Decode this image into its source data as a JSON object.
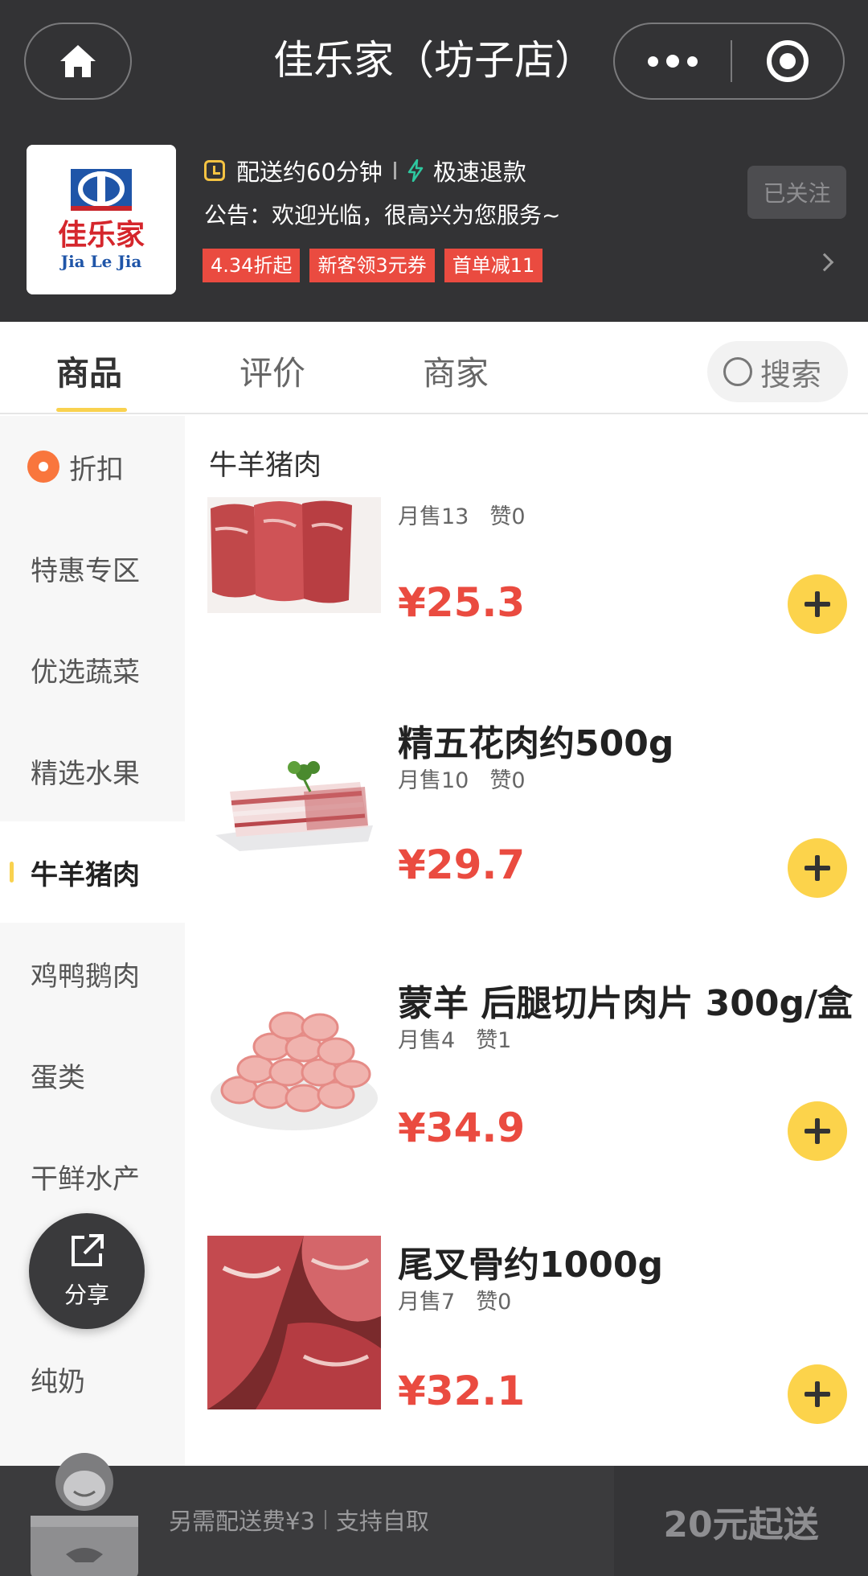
{
  "header": {
    "title": "佳乐家（坊子店）",
    "home_icon": "home-icon",
    "more_icon": "more-dots-icon",
    "close_icon": "target-circle-icon"
  },
  "store": {
    "logo_text_cn": "佳乐家",
    "logo_text_en": "Jia Le Jia",
    "delivery_time": "配送约60分钟",
    "refund": "极速退款",
    "notice": "公告：欢迎光临，很高兴为您服务~",
    "tags": [
      "4.34折起",
      "新客领3元券",
      "首单减11"
    ],
    "follow_label": "已关注"
  },
  "tabs": {
    "items": [
      "商品",
      "评价",
      "商家"
    ],
    "search_label": "搜索"
  },
  "sidebar": {
    "items": [
      {
        "label": "折扣"
      },
      {
        "label": "特惠专区"
      },
      {
        "label": "优选蔬菜"
      },
      {
        "label": "精选水果"
      },
      {
        "label": "牛羊猪肉"
      },
      {
        "label": "鸡鸭鹅肉"
      },
      {
        "label": "蛋类"
      },
      {
        "label": "干鲜水产"
      },
      {
        "label": "纯奶"
      }
    ],
    "active": "牛羊猪肉",
    "share_label": "分享"
  },
  "section_title": "牛羊猪肉",
  "products": [
    {
      "name": "",
      "sales": "月售13",
      "likes": "赞0",
      "price": "¥25.3"
    },
    {
      "name": "精五花肉约500g",
      "sales": "月售10",
      "likes": "赞0",
      "price": "¥29.7"
    },
    {
      "name": "蒙羊 后腿切片肉片 300g/盒",
      "sales": "月售4",
      "likes": "赞1",
      "price": "¥34.9"
    },
    {
      "name": "尾叉骨约1000g",
      "sales": "月售7",
      "likes": "赞0",
      "price": "¥32.1"
    }
  ],
  "bottom": {
    "delivery_fee": "另需配送费¥3",
    "self_pickup": "支持自取",
    "min_order": "20元起送"
  },
  "colors": {
    "header_bg": "#333335",
    "accent_yellow": "#fcd34b",
    "price_red": "#ea4b40",
    "tag_red": "#ea4b40"
  }
}
